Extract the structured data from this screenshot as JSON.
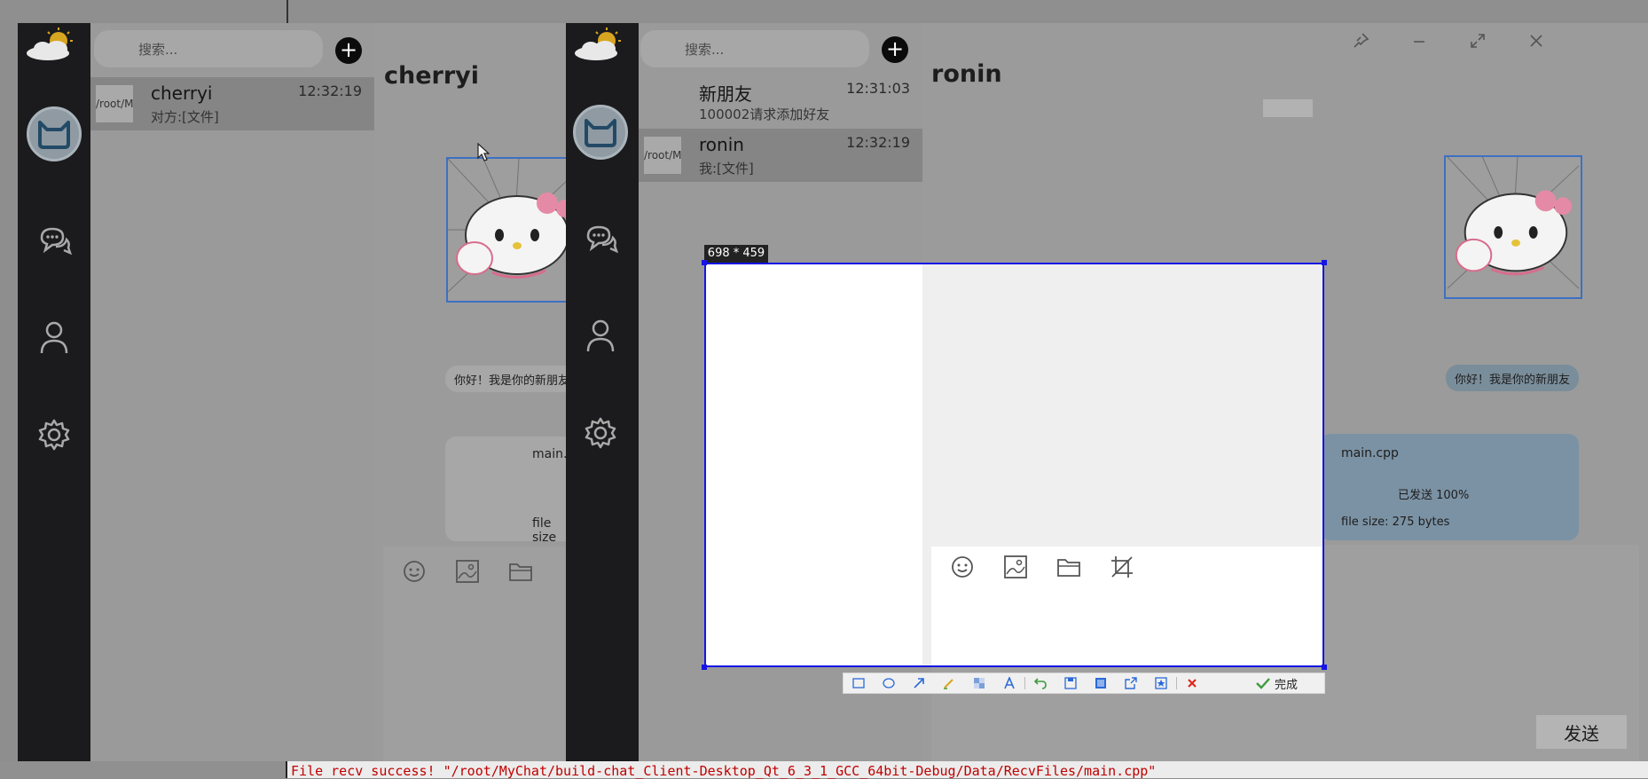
{
  "console": {
    "text": "File recv success! \"/root/MyChat/build-chat_Client-Desktop_Qt_6_3_1_GCC_64bit-Debug/Data/RecvFiles/main.cpp\""
  },
  "left_window": {
    "search_placeholder": "搜索...",
    "plus_label": "+",
    "chat_items": [
      {
        "thumb": "/root/M",
        "name": "cherryi",
        "time": "12:32:19",
        "preview": "对方:[文件]"
      }
    ],
    "chat_title": "cherryi",
    "bubble_text": "你好！我是你的新朋友",
    "file_name": "main.c",
    "file_size": "file size"
  },
  "right_window": {
    "search_placeholder": "搜索...",
    "plus_label": "+",
    "chat_items": [
      {
        "thumb": "",
        "name": "新朋友",
        "time": "12:31:03",
        "preview": "100002请求添加好友"
      },
      {
        "thumb": "/root/M",
        "name": "ronin",
        "time": "12:32:19",
        "preview": "我:[文件]"
      }
    ],
    "chat_title": "ronin",
    "bubble_text": "你好！我是你的新朋友",
    "file_name": "main.cpp",
    "file_status": "已发送 100%",
    "file_size": "file size: 275 bytes",
    "send_label": "发送",
    "window_controls": [
      "pin-icon",
      "minimize-icon",
      "maximize-icon",
      "close-icon"
    ]
  },
  "capture": {
    "dimension_label": "698 * 459",
    "finish_label": "完成",
    "tools": [
      "rectangle-icon",
      "ellipse-icon",
      "arrow-icon",
      "pen-icon",
      "mosaic-icon",
      "text-icon",
      "undo-icon",
      "save-icon",
      "copy-icon",
      "share-icon",
      "pin-icon",
      "cancel-icon"
    ]
  },
  "colors": {
    "selection": "#1515e6",
    "sidebar": "#1b1b1d",
    "kitty_border": "#3d70c2",
    "console_text": "#c00000"
  }
}
